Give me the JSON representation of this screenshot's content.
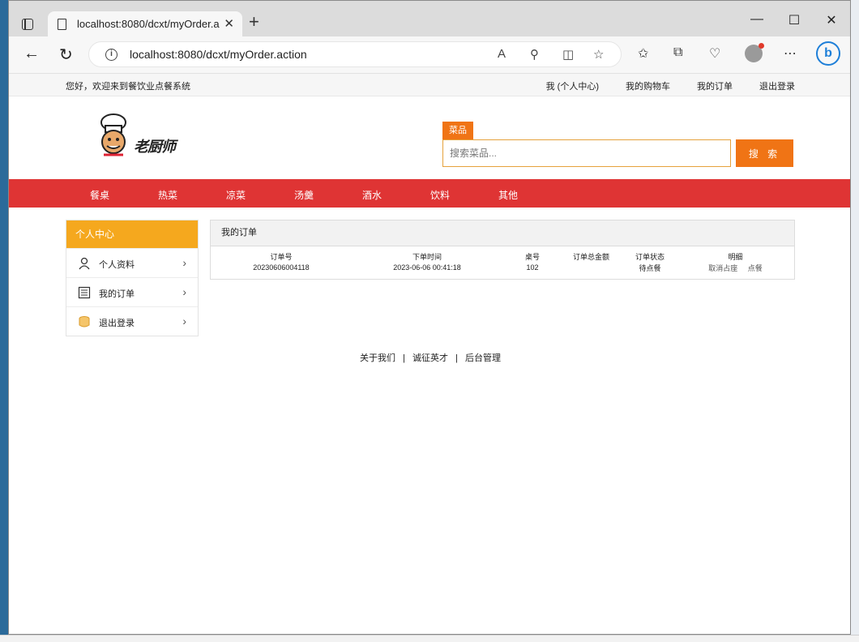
{
  "browser": {
    "tab_title": "localhost:8080/dcxt/myOrder.action",
    "url": "localhost:8080/dcxt/myOrder.action",
    "new_tab": "+",
    "close_tab": "✕"
  },
  "topbar": {
    "welcome": "您好，欢迎来到餐饮业点餐系统",
    "links": [
      "我 (个人中心)",
      "我的购物车",
      "我的订单",
      "退出登录"
    ]
  },
  "logo": {
    "text": "老厨师"
  },
  "search": {
    "tab_label": "菜品",
    "placeholder": "搜索菜品...",
    "button_label": "搜 索"
  },
  "categories": [
    "餐桌",
    "热菜",
    "凉菜",
    "汤羹",
    "酒水",
    "饮料",
    "其他"
  ],
  "sidebar": {
    "title": "个人中心",
    "items": [
      {
        "label": "个人资料",
        "icon": "user-icon"
      },
      {
        "label": "我的订单",
        "icon": "order-list-icon"
      },
      {
        "label": "退出登录",
        "icon": "logout-icon"
      }
    ]
  },
  "orders": {
    "title": "我的订单",
    "columns": [
      "订单号",
      "下单时间",
      "桌号",
      "订单总金额",
      "订单状态",
      "明细"
    ],
    "rows": [
      {
        "order_no": "20230606004118",
        "time": "2023-06-06 00:41:18",
        "table": "102",
        "total": "",
        "status": "待点餐",
        "actions": [
          "取消占座",
          "点餐"
        ]
      }
    ]
  },
  "footer": {
    "links": [
      "关于我们",
      "诚征英才",
      "后台管理"
    ],
    "separator": "|"
  },
  "colors": {
    "nav_red": "#df3434",
    "orange": "#f07415",
    "sidebar_head": "#f5a81e"
  }
}
